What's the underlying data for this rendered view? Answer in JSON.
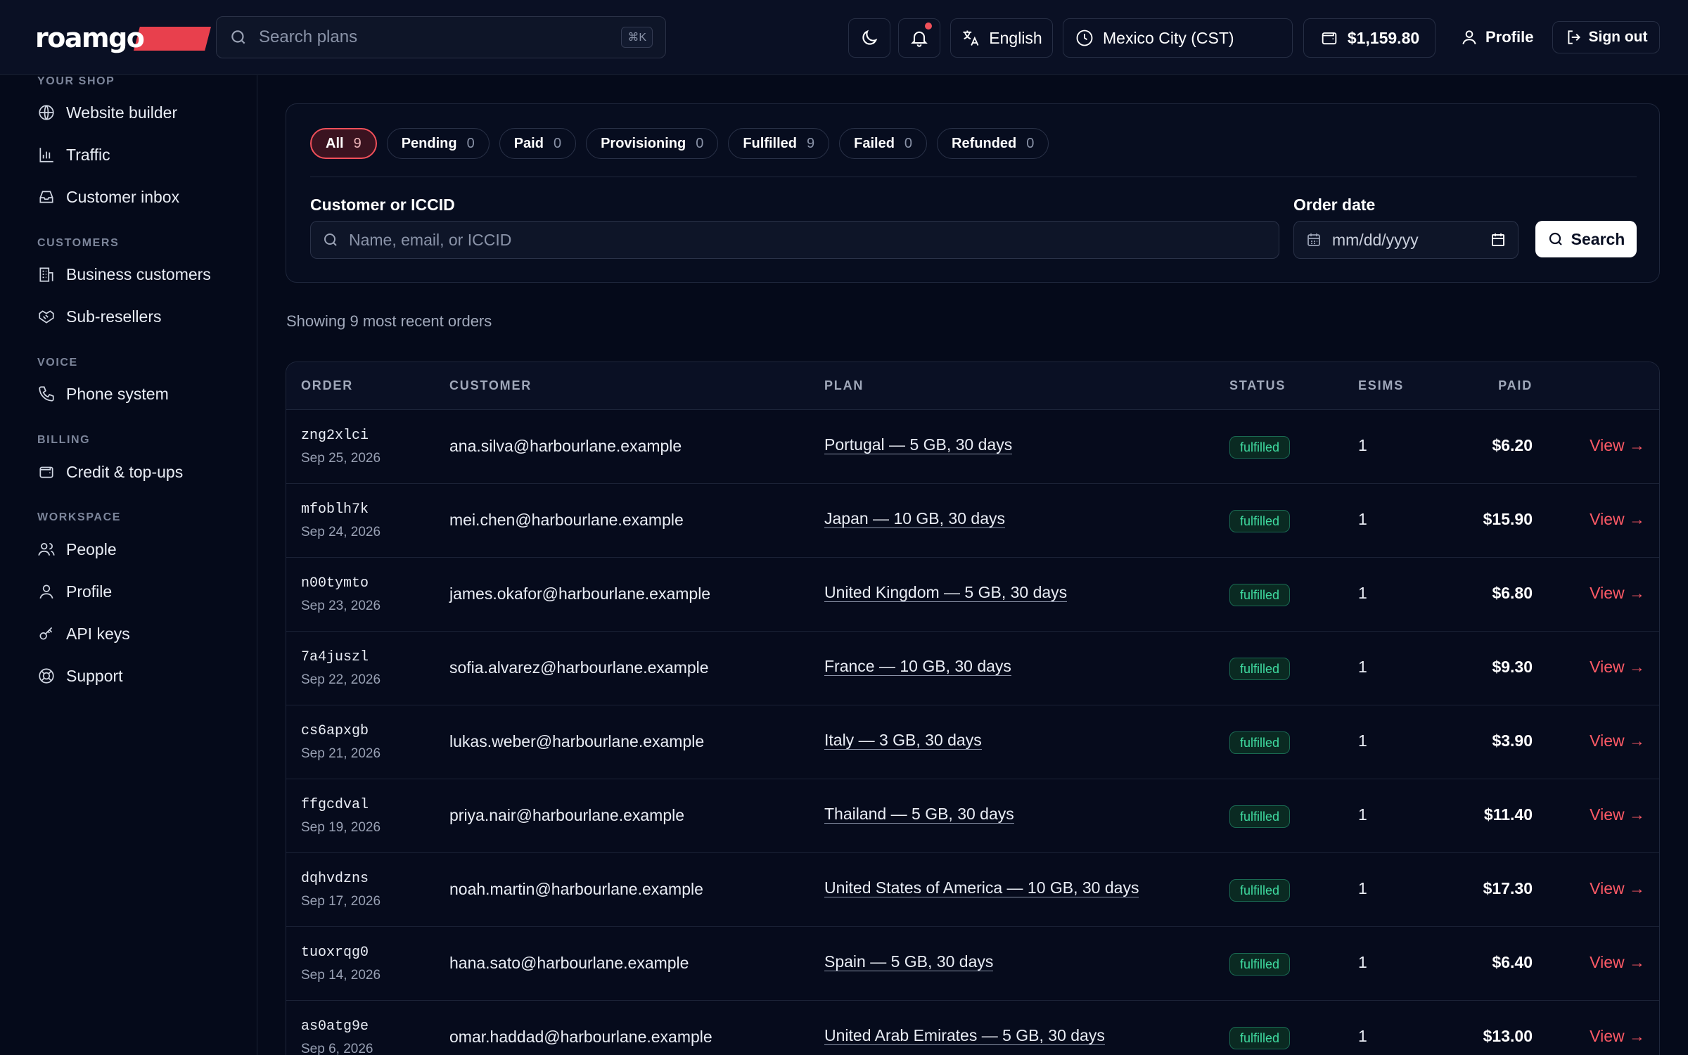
{
  "brand": {
    "name": "roamgo"
  },
  "header": {
    "search_placeholder": "Search plans",
    "search_shortcut": "⌘K",
    "language": "English",
    "timezone": "Mexico City (CST)",
    "balance": "$1,159.80",
    "profile": "Profile",
    "sign_out": "Sign out"
  },
  "sidebar": {
    "sections": [
      {
        "title": "YOUR SHOP",
        "items": [
          {
            "label": "Website builder",
            "icon": "globe-icon"
          },
          {
            "label": "Traffic",
            "icon": "bar-chart-icon"
          },
          {
            "label": "Customer inbox",
            "icon": "inbox-icon"
          }
        ]
      },
      {
        "title": "CUSTOMERS",
        "items": [
          {
            "label": "Business customers",
            "icon": "building-icon"
          },
          {
            "label": "Sub-resellers",
            "icon": "handshake-icon"
          }
        ]
      },
      {
        "title": "VOICE",
        "items": [
          {
            "label": "Phone system",
            "icon": "phone-icon"
          }
        ]
      },
      {
        "title": "BILLING",
        "items": [
          {
            "label": "Credit & top-ups",
            "icon": "wallet-icon"
          }
        ]
      },
      {
        "title": "WORKSPACE",
        "items": [
          {
            "label": "People",
            "icon": "users-icon"
          },
          {
            "label": "Profile",
            "icon": "user-icon"
          },
          {
            "label": "API keys",
            "icon": "key-icon"
          },
          {
            "label": "Support",
            "icon": "lifebuoy-icon"
          }
        ]
      }
    ]
  },
  "filters": {
    "tabs": [
      {
        "label": "All",
        "count": "9",
        "active": true
      },
      {
        "label": "Pending",
        "count": "0"
      },
      {
        "label": "Paid",
        "count": "0"
      },
      {
        "label": "Provisioning",
        "count": "0"
      },
      {
        "label": "Fulfilled",
        "count": "9"
      },
      {
        "label": "Failed",
        "count": "0"
      },
      {
        "label": "Refunded",
        "count": "0"
      }
    ],
    "customer_label": "Customer or ICCID",
    "customer_placeholder": "Name, email, or ICCID",
    "date_label": "Order date",
    "date_placeholder": "mm/dd/yyyy",
    "search_button": "Search"
  },
  "summary": "Showing 9 most recent orders",
  "table": {
    "columns": {
      "order": "ORDER",
      "customer": "CUSTOMER",
      "plan": "PLAN",
      "status": "STATUS",
      "esims": "ESIMS",
      "paid": "PAID"
    },
    "view_label": "View →",
    "rows": [
      {
        "id": "zng2xlci",
        "date": "Sep 25, 2026",
        "customer": "ana.silva@harbourlane.example",
        "plan": "Portugal — 5 GB, 30 days",
        "status": "fulfilled",
        "esims": "1",
        "paid": "$6.20"
      },
      {
        "id": "mfoblh7k",
        "date": "Sep 24, 2026",
        "customer": "mei.chen@harbourlane.example",
        "plan": "Japan — 10 GB, 30 days",
        "status": "fulfilled",
        "esims": "1",
        "paid": "$15.90"
      },
      {
        "id": "n00tymto",
        "date": "Sep 23, 2026",
        "customer": "james.okafor@harbourlane.example",
        "plan": "United Kingdom — 5 GB, 30 days",
        "status": "fulfilled",
        "esims": "1",
        "paid": "$6.80"
      },
      {
        "id": "7a4juszl",
        "date": "Sep 22, 2026",
        "customer": "sofia.alvarez@harbourlane.example",
        "plan": "France — 10 GB, 30 days",
        "status": "fulfilled",
        "esims": "1",
        "paid": "$9.30"
      },
      {
        "id": "cs6apxgb",
        "date": "Sep 21, 2026",
        "customer": "lukas.weber@harbourlane.example",
        "plan": "Italy — 3 GB, 30 days",
        "status": "fulfilled",
        "esims": "1",
        "paid": "$3.90"
      },
      {
        "id": "ffgcdval",
        "date": "Sep 19, 2026",
        "customer": "priya.nair@harbourlane.example",
        "plan": "Thailand — 5 GB, 30 days",
        "status": "fulfilled",
        "esims": "1",
        "paid": "$11.40"
      },
      {
        "id": "dqhvdzns",
        "date": "Sep 17, 2026",
        "customer": "noah.martin@harbourlane.example",
        "plan": "United States of America — 10 GB, 30 days",
        "status": "fulfilled",
        "esims": "1",
        "paid": "$17.30"
      },
      {
        "id": "tuoxrqg0",
        "date": "Sep 14, 2026",
        "customer": "hana.sato@harbourlane.example",
        "plan": "Spain — 5 GB, 30 days",
        "status": "fulfilled",
        "esims": "1",
        "paid": "$6.40"
      },
      {
        "id": "as0atg9e",
        "date": "Sep 6, 2026",
        "customer": "omar.haddad@harbourlane.example",
        "plan": "United Arab Emirates — 5 GB, 30 days",
        "status": "fulfilled",
        "esims": "1",
        "paid": "$13.00"
      }
    ]
  },
  "colors": {
    "accent": "#f0505a",
    "background": "#050a1a",
    "success": "#3fdba0"
  }
}
